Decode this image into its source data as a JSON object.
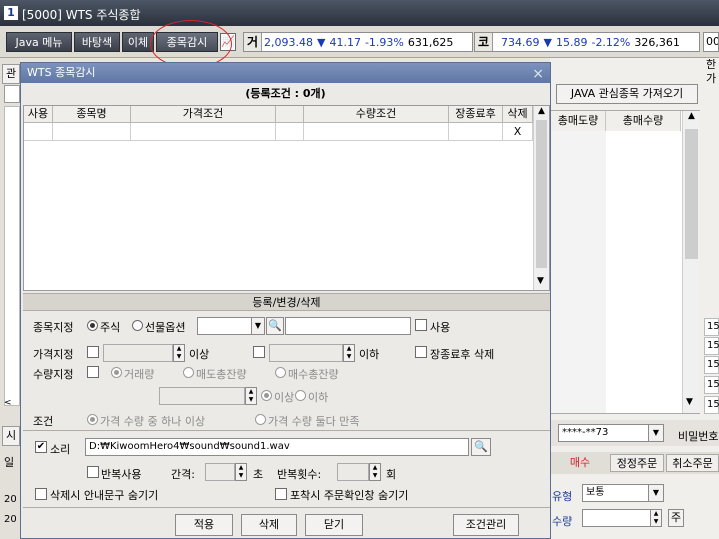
{
  "main": {
    "num": "1",
    "title": "[5000] WTS 주식종합"
  },
  "toolbar": {
    "java_menu": "Java 메뉴",
    "background": "바탕색",
    "ihche": "이체",
    "watch": "종목감시",
    "chart_icon": "📈"
  },
  "indices": [
    {
      "tag": "거",
      "value": "2,093.48",
      "arrow": "▼",
      "change": "41.17",
      "pct": "-1.93%",
      "vol": "631,625"
    },
    {
      "tag": "코",
      "value": "734.69",
      "arrow": "▼",
      "change": "15.89",
      "pct": "-2.12%",
      "vol": "326,361"
    }
  ],
  "bg": {
    "java_import": "JAVA 관심종목 가져오기",
    "col_sell": "총매도량",
    "col_buy": "총매수량",
    "account": "****-**73",
    "pw_label": "비밀번호",
    "tab_buy": "매수",
    "tab_modify": "정정주문",
    "tab_cancel": "취소주문",
    "type_label": "유형",
    "type_value": "보통",
    "qty_label": "수량",
    "qty_unit": "주",
    "mini_rows": [
      "15",
      "15",
      "15",
      "15",
      "15"
    ],
    "left_tab1": "관",
    "left_tab2": "시",
    "left_tab3": "일",
    "left_rows": [
      "20",
      "20"
    ],
    "right_top": [
      "00",
      "한",
      "가"
    ]
  },
  "dialog": {
    "title": "WTS 종목감시",
    "close": "×",
    "reg_count": "(등록조건 : 0개)",
    "columns": [
      "사용",
      "종목명",
      "가격조건",
      "",
      "수량조건",
      "장종료후",
      "삭제"
    ],
    "row_delete": "X",
    "section": "등록/변경/삭제",
    "stock_label": "종목지정",
    "radio_stock": "주식",
    "radio_futures": "선물옵션",
    "use_label": "사용",
    "price_label": "가격지정",
    "above": "이상",
    "below": "이하",
    "after_close_delete": "장종료후 삭제",
    "qty_label": "수량지정",
    "radio_volume": "거래량",
    "radio_sell_rem": "매도총잔량",
    "radio_buy_rem": "매수총잔량",
    "radio_above": "이상",
    "radio_below": "이하",
    "cond_label": "조건",
    "cond_any": "가격 수량 중 하나 이상",
    "cond_both": "가격 수량 둘다 만족",
    "sound_label": "소리",
    "sound_path": "D:₩KiwoomHero4₩sound₩sound1.wav",
    "repeat_label": "반복사용",
    "interval_label": "간격:",
    "sec": "초",
    "repeat_count": "반복횟수:",
    "times": "회",
    "hide_delete_msg": "삭제시 안내문구 숨기기",
    "hide_capture_msg": "포착시 주문확인창 숨기기",
    "btn_apply": "적용",
    "btn_delete": "삭제",
    "btn_close": "닫기",
    "btn_manage": "조건관리"
  }
}
